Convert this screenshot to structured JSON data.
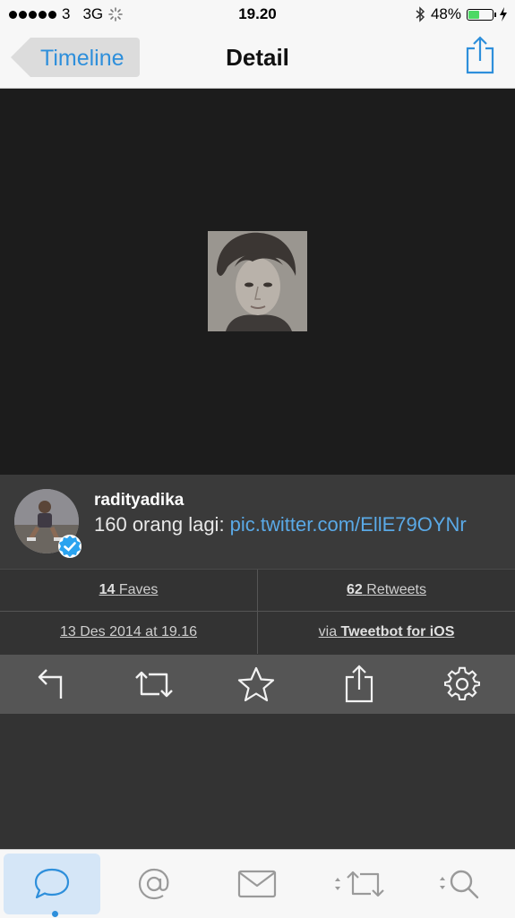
{
  "status_bar": {
    "carrier": "3",
    "network": "3G",
    "time": "19.20",
    "battery": "48%",
    "battery_level": 0.48
  },
  "nav": {
    "back_label": "Timeline",
    "title": "Detail"
  },
  "tweet": {
    "username": "radityadika",
    "text": "160 orang lagi: ",
    "link": "pic.twitter.com/EllE79OYNr"
  },
  "stats": {
    "faves_count": "14",
    "faves_label": "Faves",
    "retweets_count": "62",
    "retweets_label": "Retweets",
    "date": "13 Des 2014 at 19.16",
    "via_prefix": "via",
    "client": "Tweetbot for iOS"
  },
  "colors": {
    "accent": "#2e8fdb",
    "link": "#5aa9e6",
    "battery": "#4cd964"
  },
  "actions": [
    "reply-icon",
    "retweet-icon",
    "star-icon",
    "share-icon",
    "gear-icon"
  ],
  "tabs": [
    "chat-bubble-icon",
    "at-sign-icon",
    "envelope-icon",
    "retweet-icon",
    "search-icon"
  ]
}
